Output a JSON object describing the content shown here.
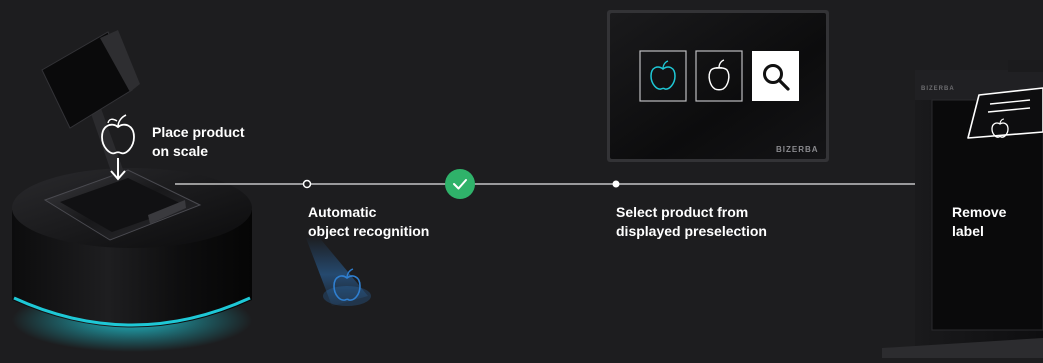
{
  "steps": [
    {
      "line1": "Place product",
      "line2": "on scale"
    },
    {
      "line1": "Automatic",
      "line2": "object recognition"
    },
    {
      "line1": "Select product from",
      "line2": "displayed preselection"
    },
    {
      "line1": "Remove",
      "line2": "label"
    }
  ],
  "brand": {
    "screen": "BIZERBA",
    "printer": "BIZERBA"
  },
  "icons": {
    "place": "apple-outline-icon",
    "arrow": "arrow-down-icon",
    "check": "checkmark-circle-icon",
    "screen_item1": "apple-icon",
    "screen_item2": "pepper-icon",
    "screen_item3": "search-icon",
    "label": "label-apple-icon",
    "projection": "apple-projection-icon"
  },
  "colors": {
    "background": "#1d1d1f",
    "text": "#ffffff",
    "accent_green": "#2fb26a",
    "accent_cyan": "#1ec8d6",
    "projection_blue": "#2f7fd0",
    "timeline": "#e6e6e6"
  }
}
